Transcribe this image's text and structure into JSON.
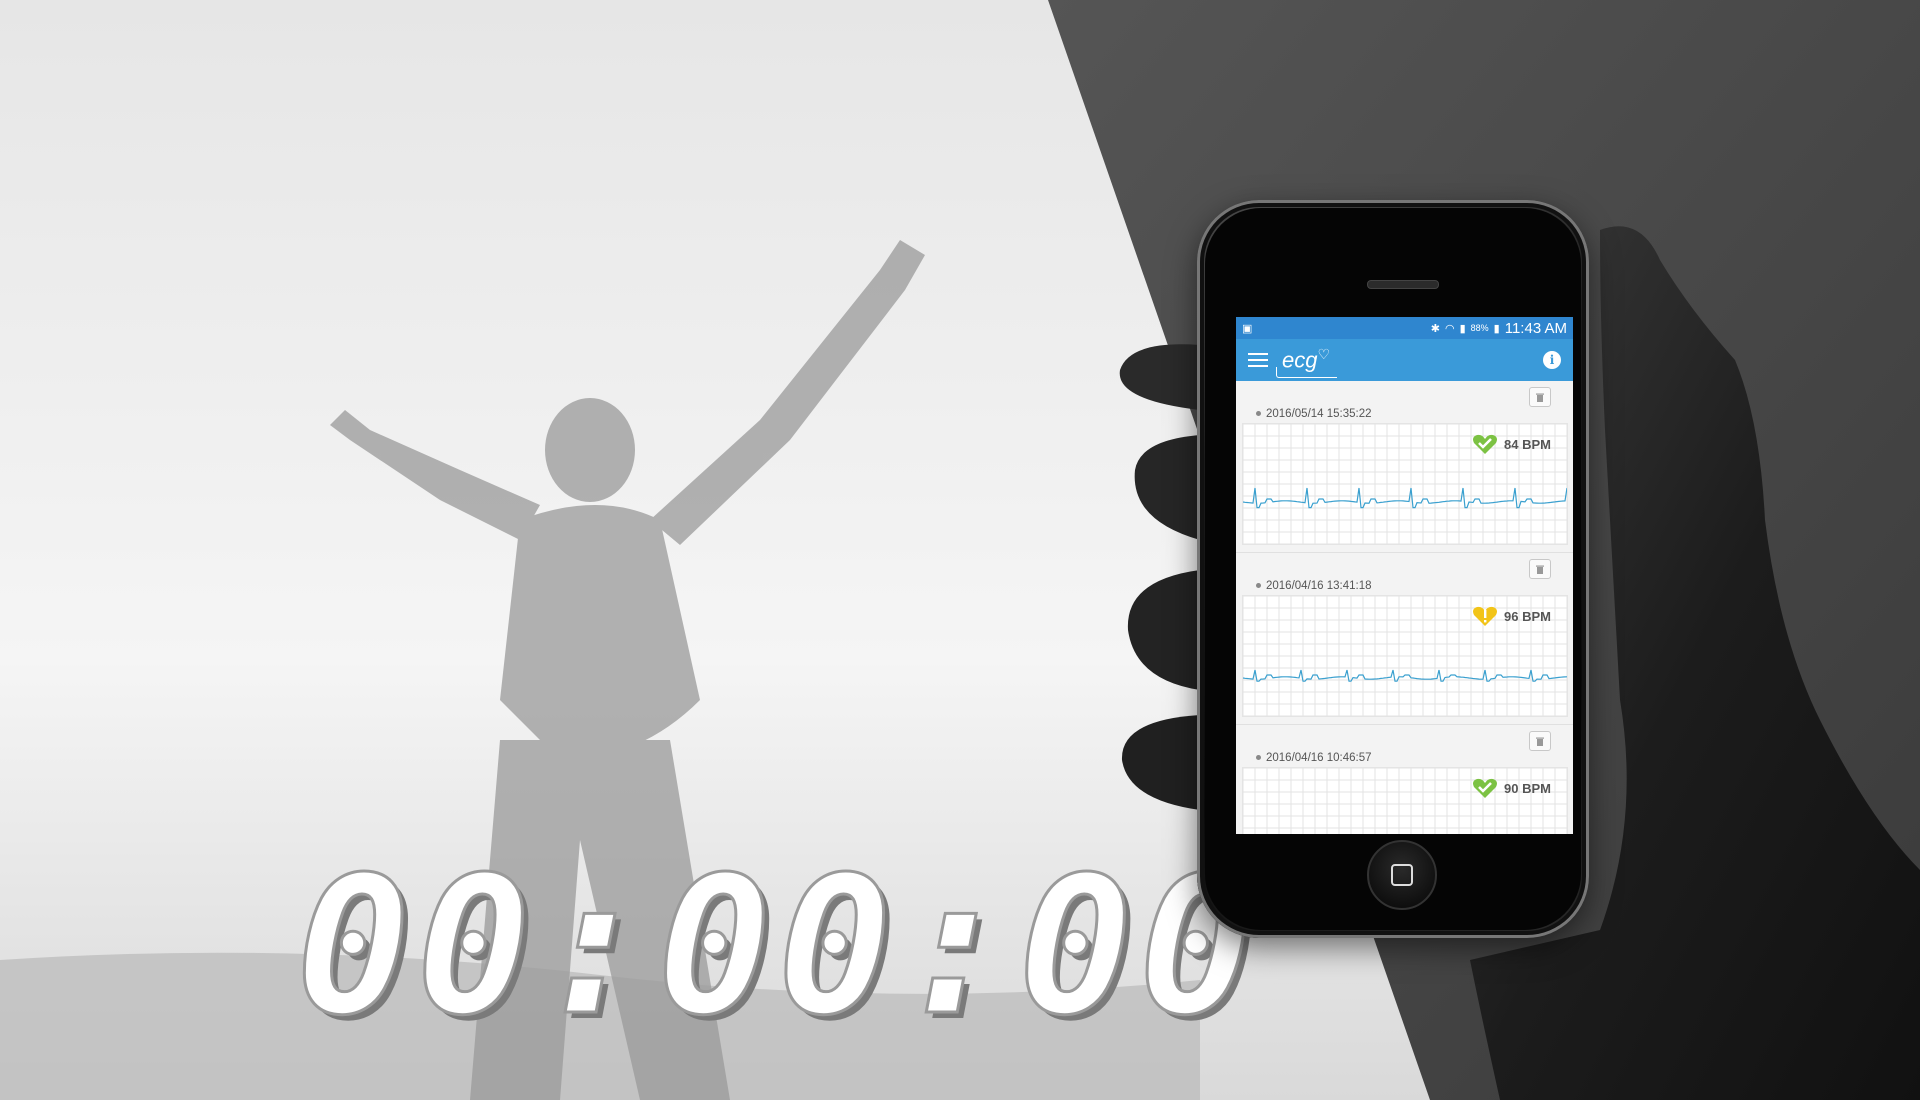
{
  "timer": {
    "text": "00:00:00"
  },
  "statusbar": {
    "battery": "88%",
    "time": "11:43 AM"
  },
  "app": {
    "logo_text": "ecg",
    "logo_heart": "♡"
  },
  "colors": {
    "accent": "#3a9ad9",
    "ok": "#7cc243",
    "warn": "#f2c418",
    "trace": "#3aa0cf"
  },
  "records": [
    {
      "timestamp": "2016/05/14 15:35:22",
      "bpm": "84 BPM",
      "status": "ok"
    },
    {
      "timestamp": "2016/04/16 13:41:18",
      "bpm": "96 BPM",
      "status": "warn"
    },
    {
      "timestamp": "2016/04/16 10:46:57",
      "bpm": "90 BPM",
      "status": "ok"
    }
  ]
}
